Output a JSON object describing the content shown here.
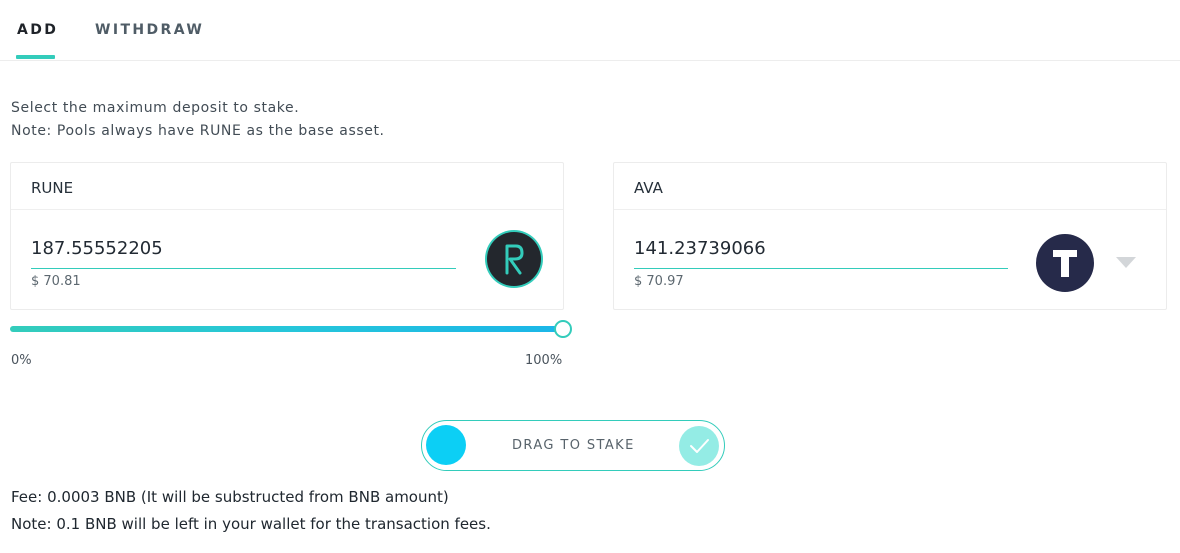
{
  "tabs": [
    {
      "label": "ADD",
      "active": true
    },
    {
      "label": "WITHDRAW",
      "active": false
    }
  ],
  "intro": {
    "line1": "Select the maximum deposit to stake.",
    "line2": "Note: Pools always have RUNE as the base asset."
  },
  "cards": [
    {
      "title": "RUNE",
      "amount": "187.55552205",
      "usd": "$ 70.81",
      "icon": "rune-coin-icon",
      "icon_letter": "R"
    },
    {
      "title": "AVA",
      "amount": "141.23739066",
      "usd": "$ 70.97",
      "icon": "ava-coin-icon",
      "icon_letter": "T"
    }
  ],
  "slider": {
    "min_label": "0%",
    "max_label": "100%",
    "value_percent": 100
  },
  "drag_to_stake": {
    "label": "DRAG TO STAKE"
  },
  "notes": {
    "fee": "Fee: 0.0003 BNB (It will be substructed from BNB amount)",
    "wallet": "Note: 0.1 BNB will be left in your wallet for the transaction fees."
  },
  "colors": {
    "accent": "#33ccbb",
    "handle": "#0ccff5",
    "check_bg": "#94ece5"
  }
}
